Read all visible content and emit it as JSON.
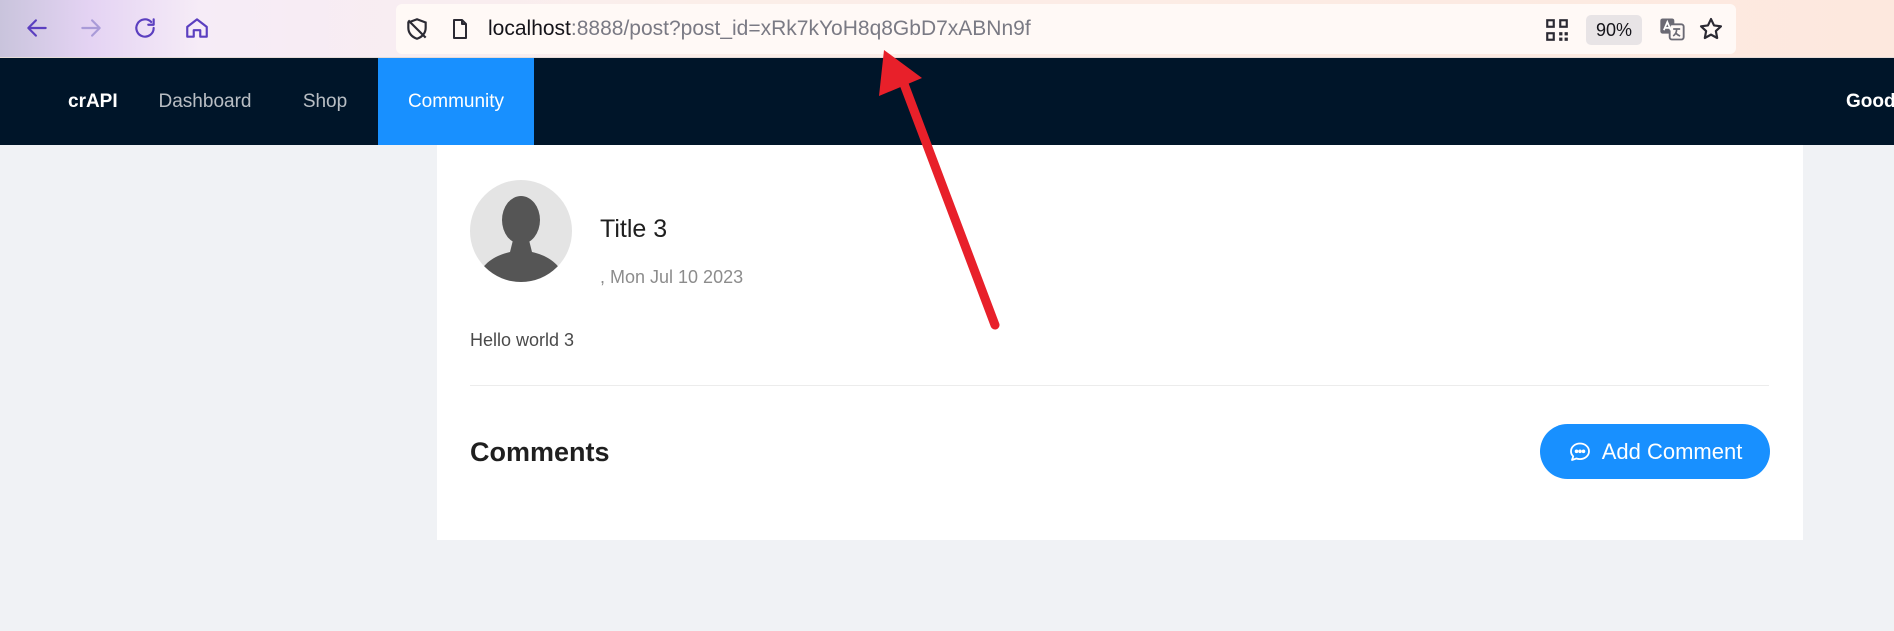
{
  "browser": {
    "url_host": "localhost",
    "url_rest": ":8888/post?post_id=xRk7kYoH8q8GbD7xABNn9f",
    "zoom": "90%"
  },
  "header": {
    "brand": "crAPI",
    "menu": [
      {
        "label": "Dashboard"
      },
      {
        "label": "Shop"
      },
      {
        "label": "Community",
        "active": true
      }
    ],
    "greeting": "Good"
  },
  "post": {
    "title": "Title 3",
    "meta": ", Mon Jul 10 2023",
    "body": "Hello world 3"
  },
  "comments": {
    "heading": "Comments",
    "add_button_label": "Add Comment"
  },
  "colors": {
    "header_bg": "#001529",
    "accent": "#1890ff",
    "annotation_arrow": "#e8202a"
  }
}
